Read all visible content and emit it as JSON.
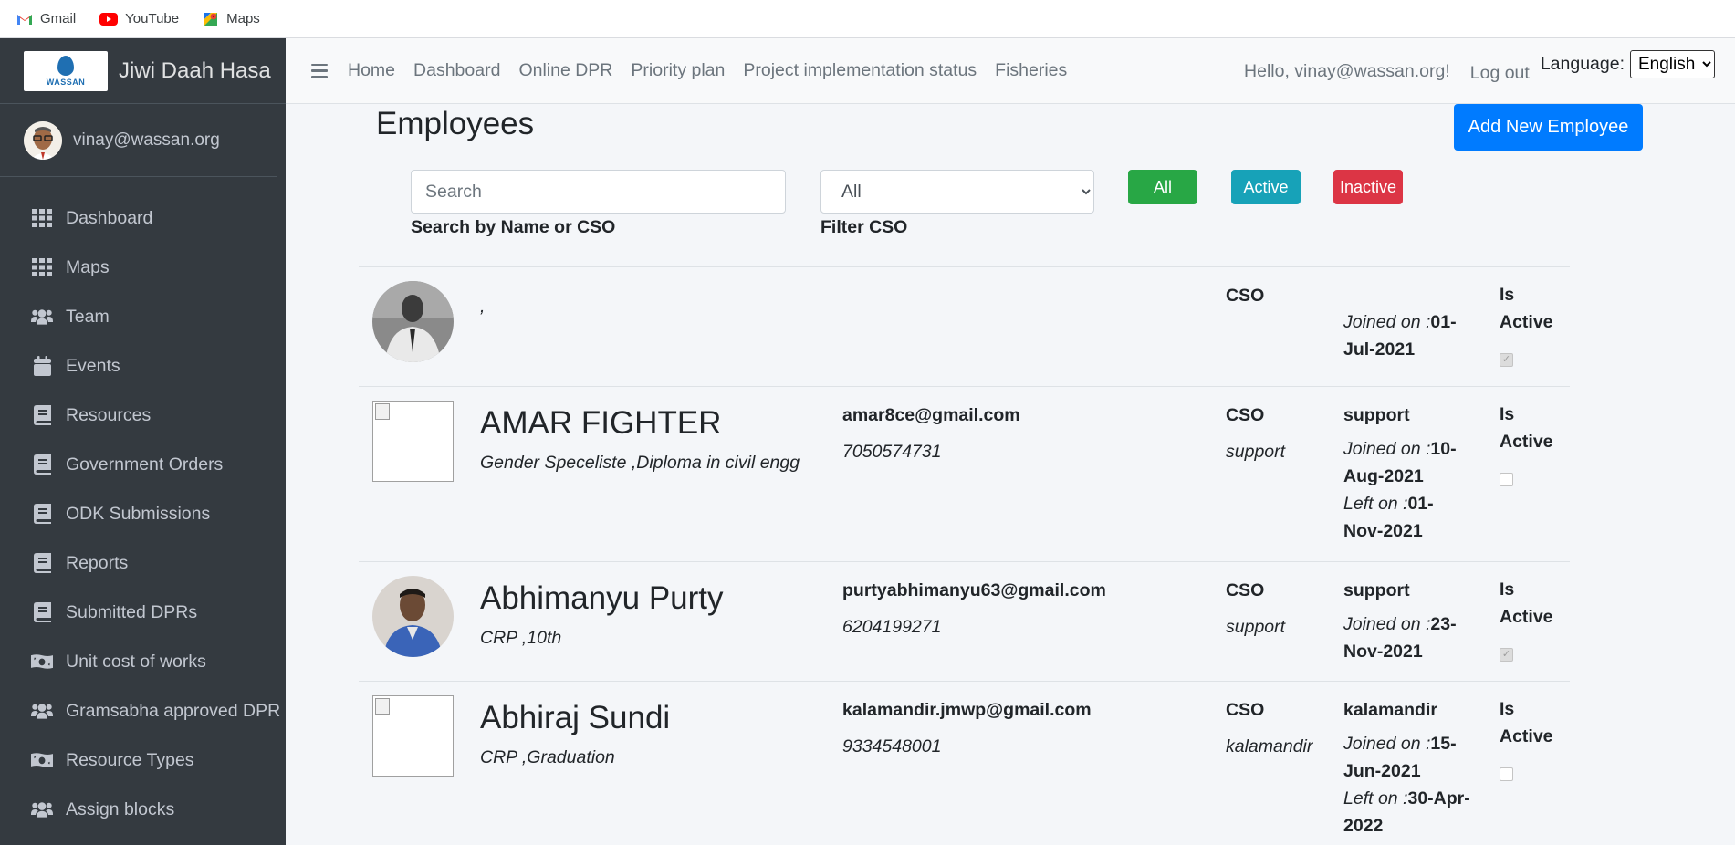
{
  "bookmarks": [
    {
      "label": "Gmail",
      "icon": "gmail-icon"
    },
    {
      "label": "YouTube",
      "icon": "youtube-icon"
    },
    {
      "label": "Maps",
      "icon": "maps-icon"
    }
  ],
  "brand": {
    "name": "Jiwi Daah Hasa",
    "logo_text": "WASSAN"
  },
  "user": {
    "email": "vinay@wassan.org"
  },
  "sidebar": {
    "items": [
      {
        "label": "Dashboard",
        "icon": "grid-icon"
      },
      {
        "label": "Maps",
        "icon": "grid-icon"
      },
      {
        "label": "Team",
        "icon": "users-icon"
      },
      {
        "label": "Events",
        "icon": "calendar-icon"
      },
      {
        "label": "Resources",
        "icon": "book-icon"
      },
      {
        "label": "Government Orders",
        "icon": "book-icon"
      },
      {
        "label": "ODK Submissions",
        "icon": "book-icon"
      },
      {
        "label": "Reports",
        "icon": "book-icon"
      },
      {
        "label": "Submitted DPRs",
        "icon": "book-icon"
      },
      {
        "label": "Unit cost of works",
        "icon": "money-icon"
      },
      {
        "label": "Gramsabha approved DPR",
        "icon": "users-icon"
      },
      {
        "label": "Resource Types",
        "icon": "money-icon"
      },
      {
        "label": "Assign blocks",
        "icon": "users-icon"
      }
    ]
  },
  "topnav": {
    "links": [
      "Home",
      "Dashboard",
      "Online DPR",
      "Priority plan",
      "Project implementation status",
      "Fisheries"
    ],
    "hello": "Hello, vinay@wassan.org!",
    "logout": "Log out",
    "language_label": "Language:",
    "language_value": "English"
  },
  "page": {
    "title": "Employees",
    "add_button": "Add New Employee",
    "search_placeholder": "Search",
    "search_label": "Search by Name or CSO",
    "cso_filter_value": "All",
    "cso_filter_label": "Filter CSO",
    "filter_all": "All",
    "filter_active": "Active",
    "filter_inactive": "Inactive"
  },
  "employees": [
    {
      "name": "",
      "subtitle": ",",
      "email": "",
      "phone": "",
      "cso_label": "CSO",
      "cso": "",
      "dept": "",
      "joined_label": "Joined on :",
      "joined": "01-Jul-2021",
      "left_label": "",
      "left": "",
      "is_active_label": "Is Active",
      "active": true
    },
    {
      "name": "AMAR FIGHTER",
      "subtitle": "Gender Speceliste ,Diploma in civil engg",
      "email": "amar8ce@gmail.com",
      "phone": "7050574731",
      "cso_label": "CSO",
      "cso": "support",
      "dept": "support",
      "joined_label": "Joined on :",
      "joined": "10-Aug-2021",
      "left_label": "Left on :",
      "left": "01-Nov-2021",
      "is_active_label": "Is Active",
      "active": false
    },
    {
      "name": "Abhimanyu Purty",
      "subtitle": "CRP ,10th",
      "email": "purtyabhimanyu63@gmail.com",
      "phone": "6204199271",
      "cso_label": "CSO",
      "cso": "support",
      "dept": "support",
      "joined_label": "Joined on :",
      "joined": "23-Nov-2021",
      "left_label": "",
      "left": "",
      "is_active_label": "Is Active",
      "active": true
    },
    {
      "name": "Abhiraj Sundi",
      "subtitle": "CRP ,Graduation",
      "email": "kalamandir.jmwp@gmail.com",
      "phone": "9334548001",
      "cso_label": "CSO",
      "cso": "kalamandir",
      "dept": "kalamandir",
      "joined_label": "Joined on :",
      "joined": "15-Jun-2021",
      "left_label": "Left on :",
      "left": "30-Apr-2022",
      "is_active_label": "Is Active",
      "active": false
    }
  ]
}
